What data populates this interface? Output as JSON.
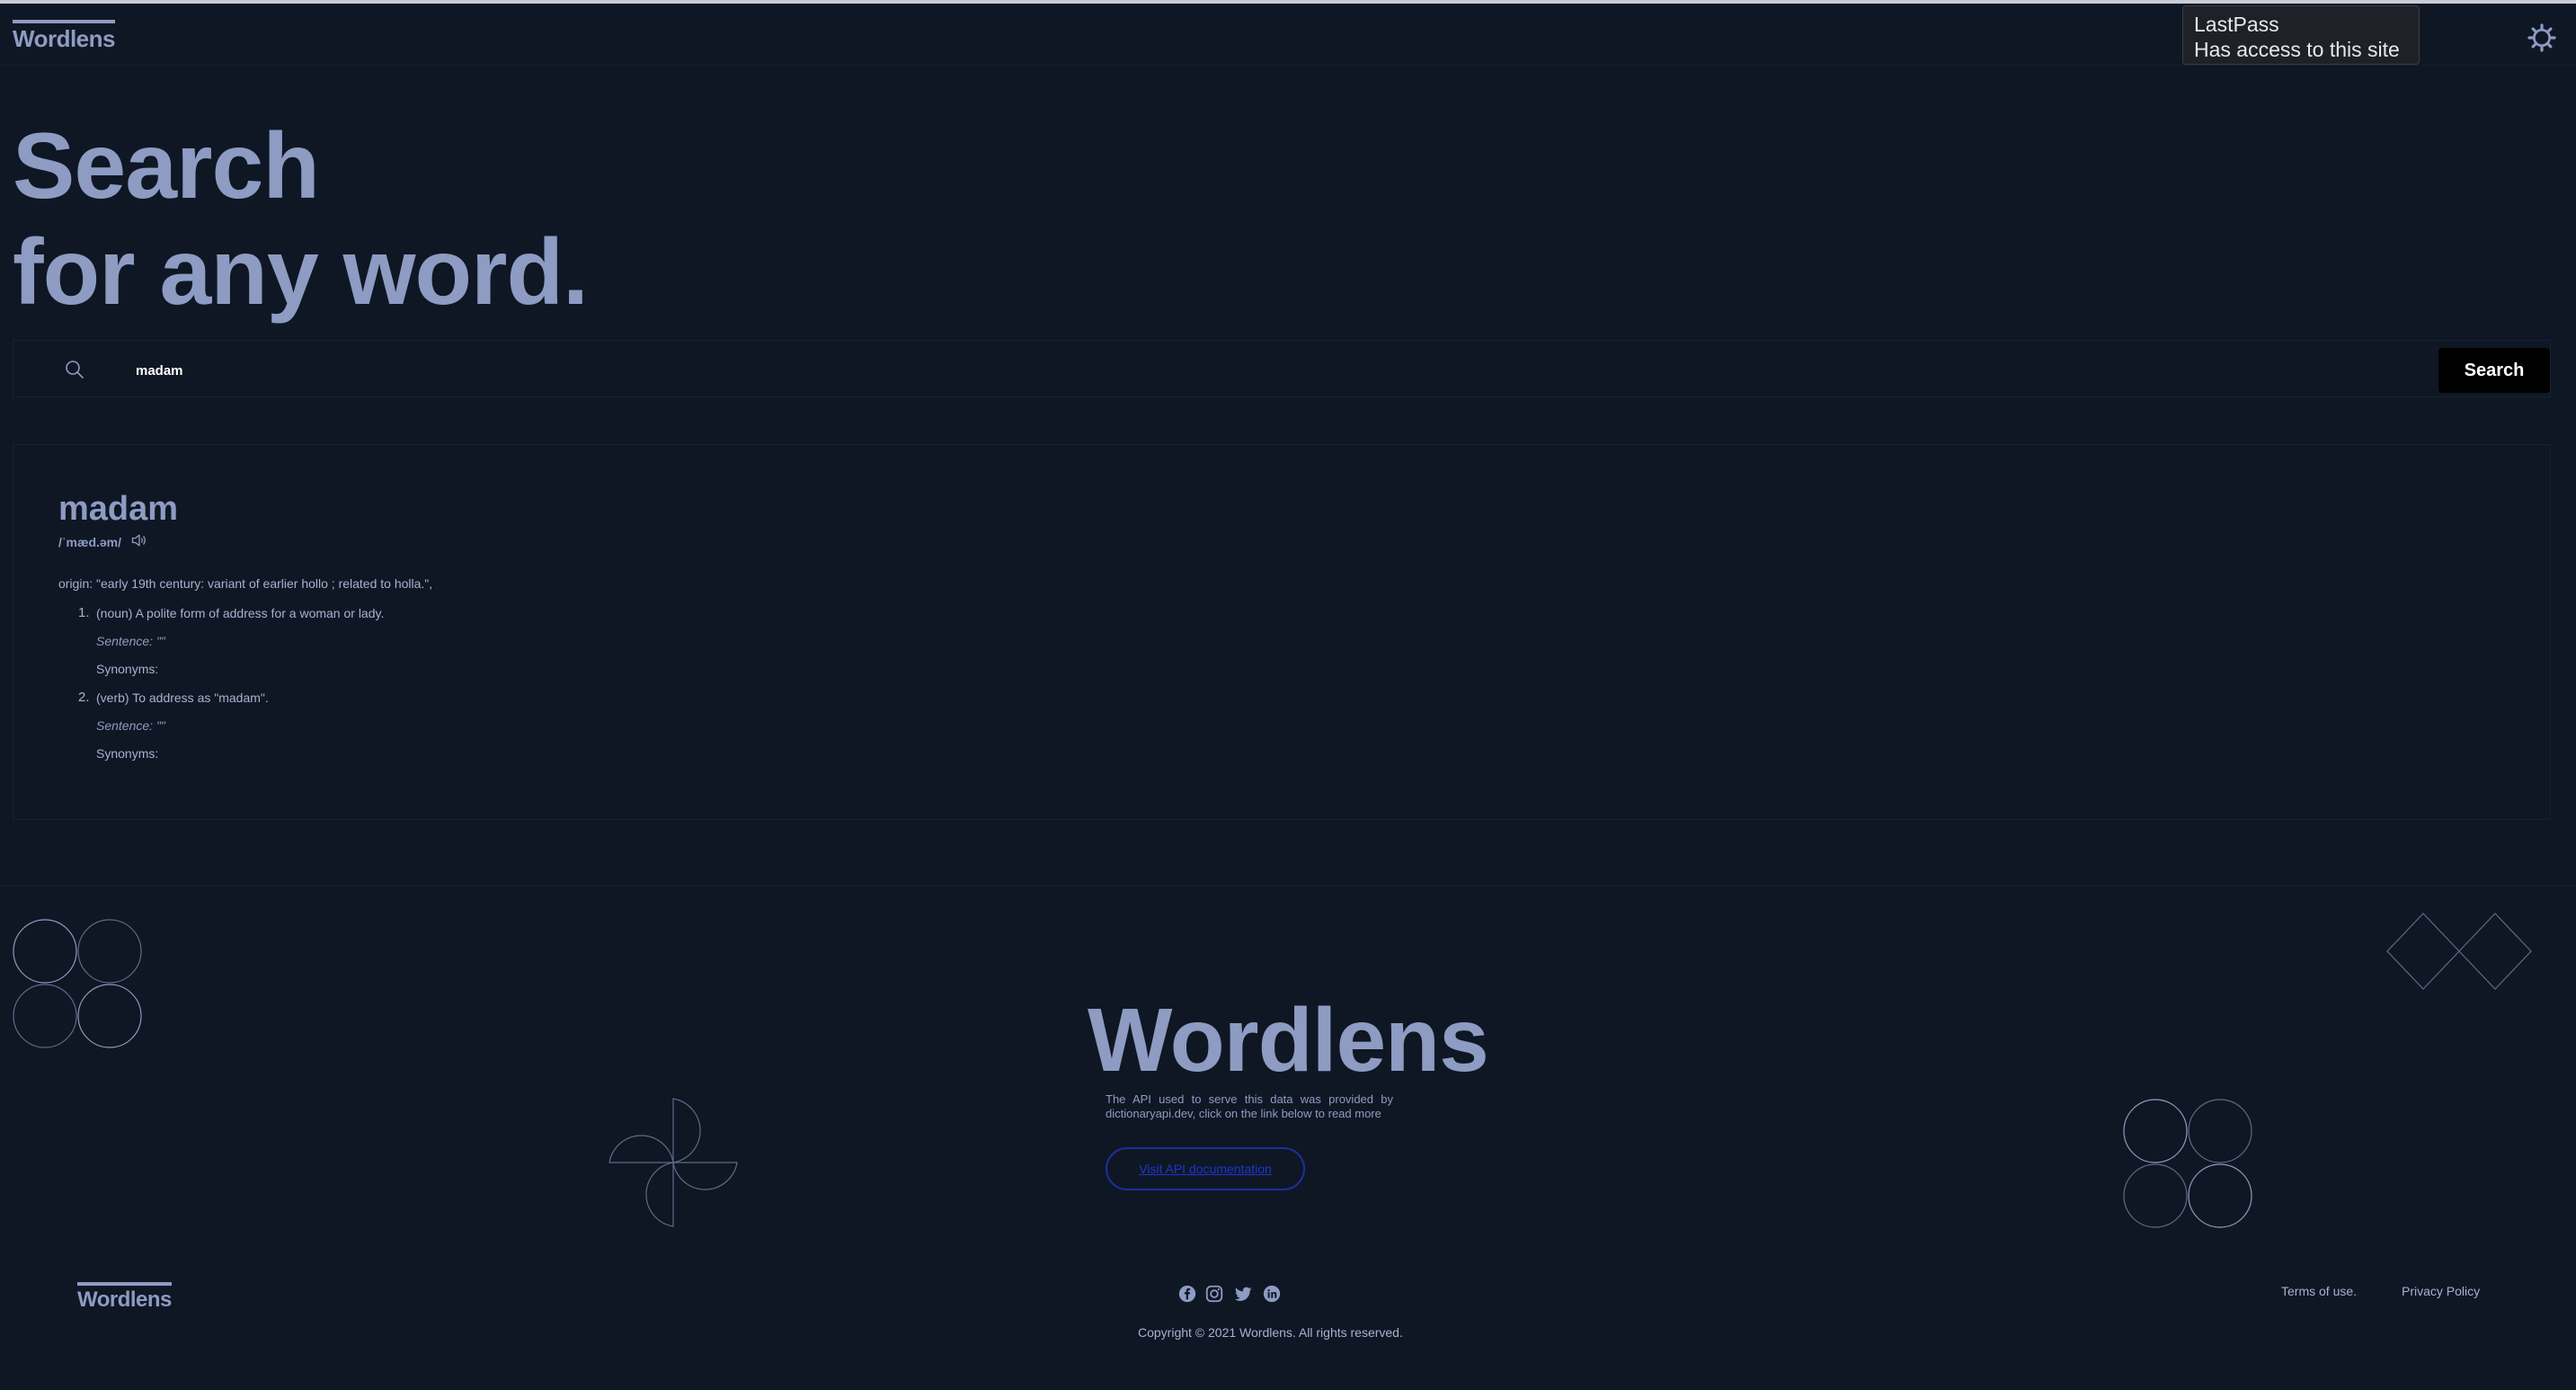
{
  "app": {
    "logo": "Wordlens",
    "hero_line1": "Search",
    "hero_line2": "for any word."
  },
  "lastpass": {
    "title": "LastPass",
    "subtitle": "Has access to this site"
  },
  "search": {
    "value": "madam",
    "placeholder": "",
    "button_label": "Search"
  },
  "result": {
    "word": "madam",
    "phonetic": "/ˈmæd.əm/",
    "origin": "origin: \"early 19th century: variant of earlier hollo ; related to holla.\",",
    "meanings": [
      {
        "number": "1.",
        "definition": "(noun) A polite form of address for a woman or lady.",
        "sentence": "Sentence: \"\"",
        "synonyms": "Synonyms:"
      },
      {
        "number": "2.",
        "definition": "(verb) To address as \"madam\".",
        "sentence": "Sentence: \"\"",
        "synonyms": "Synonyms:"
      }
    ]
  },
  "footer": {
    "title": "Wordlens",
    "description": "The API used to serve this data was provided by dictionaryapi.dev, click on the link below to read more",
    "api_button": "Visit API documentation",
    "logo": "Wordlens",
    "copyright": "Copyright © 2021 Wordlens. All rights reserved.",
    "terms": "Terms of use.",
    "privacy": "Privacy Policy",
    "socials": [
      "facebook-icon",
      "instagram-icon",
      "twitter-icon",
      "linkedin-icon"
    ]
  },
  "colors": {
    "background": "#0f1724",
    "accent": "#8e9bc2",
    "search_button": "#000000",
    "link": "#1e36d0"
  }
}
